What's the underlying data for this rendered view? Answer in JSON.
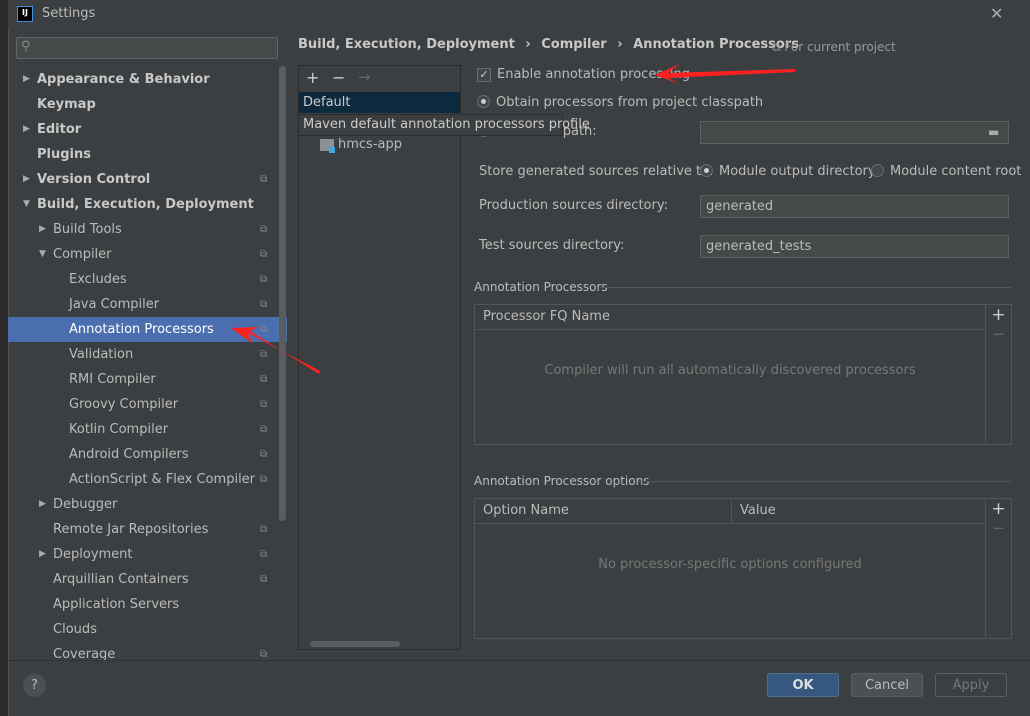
{
  "window": {
    "title": "Settings",
    "close": "✕"
  },
  "search": {
    "placeholder": ""
  },
  "sidebar": {
    "items": [
      {
        "label": "Appearance & Behavior",
        "level": 0,
        "arrow": "▶",
        "bold": true
      },
      {
        "label": "Keymap",
        "level": 0,
        "bold": true
      },
      {
        "label": "Editor",
        "level": 0,
        "arrow": "▶",
        "bold": true
      },
      {
        "label": "Plugins",
        "level": 0,
        "bold": true
      },
      {
        "label": "Version Control",
        "level": 0,
        "arrow": "▶",
        "bold": true,
        "copy": true
      },
      {
        "label": "Build, Execution, Deployment",
        "level": 0,
        "arrow": "▼",
        "bold": true
      },
      {
        "label": "Build Tools",
        "level": 1,
        "arrow": "▶",
        "copy": true
      },
      {
        "label": "Compiler",
        "level": 1,
        "arrow": "▼",
        "copy": true
      },
      {
        "label": "Excludes",
        "level": 2,
        "copy": true
      },
      {
        "label": "Java Compiler",
        "level": 2,
        "copy": true
      },
      {
        "label": "Annotation Processors",
        "level": 2,
        "copy": true,
        "selected": true
      },
      {
        "label": "Validation",
        "level": 2,
        "copy": true
      },
      {
        "label": "RMI Compiler",
        "level": 2,
        "copy": true
      },
      {
        "label": "Groovy Compiler",
        "level": 2,
        "copy": true
      },
      {
        "label": "Kotlin Compiler",
        "level": 2,
        "copy": true
      },
      {
        "label": "Android Compilers",
        "level": 2,
        "copy": true
      },
      {
        "label": "ActionScript & Flex Compiler",
        "level": 2,
        "copy": true
      },
      {
        "label": "Debugger",
        "level": 1,
        "arrow": "▶"
      },
      {
        "label": "Remote Jar Repositories",
        "level": 1,
        "copy": true
      },
      {
        "label": "Deployment",
        "level": 1,
        "arrow": "▶",
        "copy": true
      },
      {
        "label": "Arquillian Containers",
        "level": 1,
        "copy": true
      },
      {
        "label": "Application Servers",
        "level": 1
      },
      {
        "label": "Clouds",
        "level": 1
      },
      {
        "label": "Coverage",
        "level": 1,
        "copy": true
      }
    ]
  },
  "breadcrumb": {
    "items": [
      "Build, Execution, Deployment",
      "Compiler",
      "Annotation Processors"
    ],
    "sep": "›",
    "scope": "For current project"
  },
  "profiles": {
    "add": "+",
    "remove": "−",
    "move": "→",
    "default": "Default",
    "tooltip": "Maven default annotation processors profile",
    "module": "hmcs-app"
  },
  "settings": {
    "enable_label": "Enable annotation processing",
    "enable_checked": true,
    "obtain_label": "Obtain processors from project classpath",
    "processor_path_label": "Processor path:",
    "processor_path_value": "",
    "store_label": "Store generated sources relative to:",
    "module_output": "Module output directory",
    "module_content": "Module content root",
    "prod_label": "Production sources directory:",
    "prod_value": "generated",
    "test_label": "Test sources directory:",
    "test_value": "generated_tests"
  },
  "processors": {
    "section": "Annotation Processors",
    "column": "Processor FQ Name",
    "empty": "Compiler will run all automatically discovered processors",
    "add": "+",
    "remove": "−"
  },
  "options": {
    "section": "Annotation Processor options",
    "columns": [
      "Option Name",
      "Value"
    ],
    "empty": "No processor-specific options configured",
    "add": "+",
    "remove": "−"
  },
  "footer": {
    "help": "?",
    "ok": "OK",
    "cancel": "Cancel",
    "apply": "Apply"
  },
  "colors": {
    "selection": "#4b6eaf",
    "ok": "#365880",
    "arrow": "#ff2020"
  }
}
